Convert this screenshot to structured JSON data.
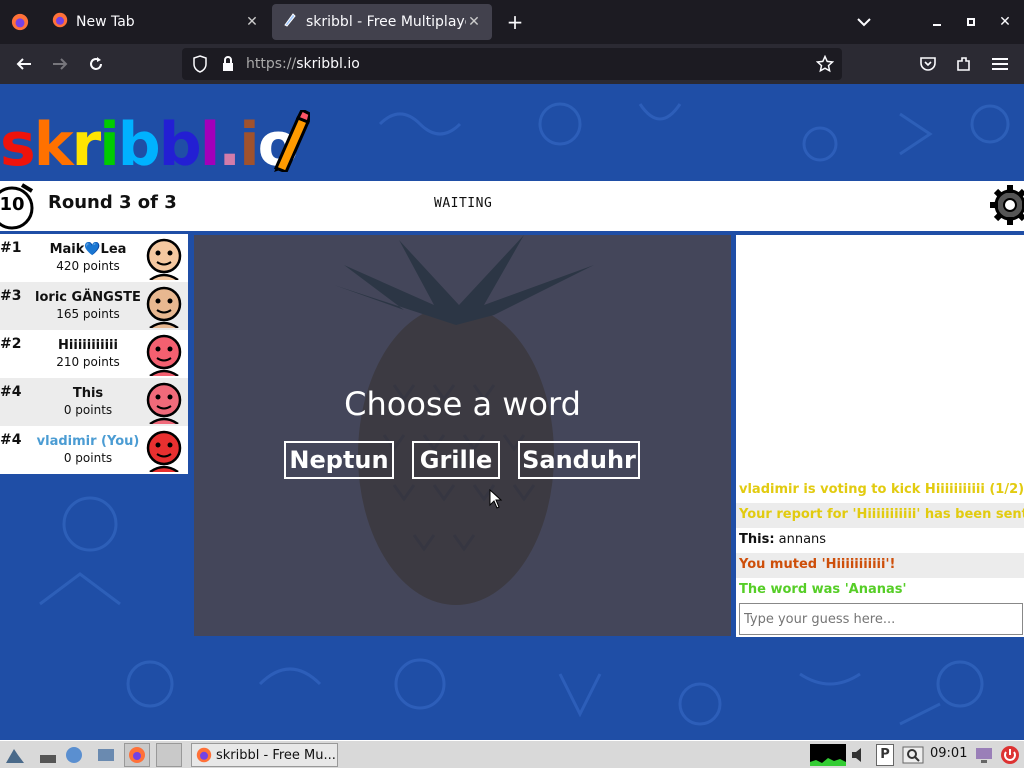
{
  "browser": {
    "tabs": [
      {
        "label": "New Tab",
        "active": false
      },
      {
        "label": "skribbl - Free Multiplayer Drawing & Guessing Game",
        "active": true
      }
    ],
    "url_protocol": "https://",
    "url_host": "skribbl.io"
  },
  "game": {
    "logo": "skribbl.io",
    "timer": "10",
    "round": "Round 3 of 3",
    "status": "WAITING",
    "players": [
      {
        "rank": "#1",
        "name": "Maik💙Lea",
        "points": "420 points",
        "avatar_color": "#f5c8a0",
        "you": false
      },
      {
        "rank": "#3",
        "name": "loric GÄNGSTE",
        "points": "165 points",
        "avatar_color": "#e8b890",
        "you": false
      },
      {
        "rank": "#2",
        "name": "Hiiiiiiiiiii",
        "points": "210 points",
        "avatar_color": "#f46070",
        "you": false
      },
      {
        "rank": "#4",
        "name": "This",
        "points": "0 points",
        "avatar_color": "#f06a7a",
        "you": false
      },
      {
        "rank": "#4",
        "name": "vladimir (You)",
        "points": "0 points",
        "avatar_color": "#e83030",
        "you": true
      }
    ],
    "prompt": "Choose a word",
    "words": [
      "Neptun",
      "Grille",
      "Sanduhr"
    ]
  },
  "chat": {
    "messages": [
      {
        "author": "",
        "text": "vladimir is voting to kick Hiiiiiiiiiii (1/2)",
        "color": "#e2cb10"
      },
      {
        "author": "",
        "text": "Your report for 'Hiiiiiiiiiii' has been sent!",
        "color": "#e2cb10"
      },
      {
        "author": "This:",
        "text": " annans",
        "color": "#111111"
      },
      {
        "author": "",
        "text": "You muted 'Hiiiiiiiiiii'!",
        "color": "#ce4f0a"
      },
      {
        "author": "",
        "text": "The word was 'Ananas'",
        "color": "#56ce27"
      }
    ],
    "placeholder": "Type your guess here..."
  },
  "taskbar": {
    "window_label": "skribbl - Free Mu...",
    "clock": "09:01"
  }
}
